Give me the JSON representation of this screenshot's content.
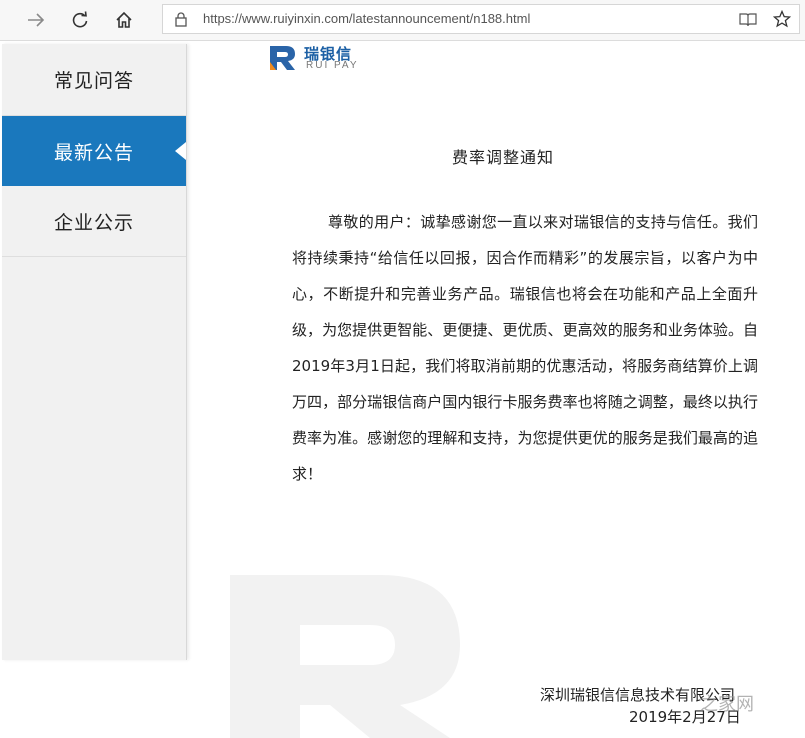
{
  "browser": {
    "url": "https://www.ruiyinxin.com/latestannouncement/n188.html"
  },
  "sidebar": {
    "items": [
      {
        "label": "常见问答"
      },
      {
        "label": "最新公告"
      },
      {
        "label": "企业公示"
      }
    ],
    "active_index": 1,
    "accent_color": "#1a78bd"
  },
  "logo": {
    "cn": "瑞银信",
    "en": "RUI PAY"
  },
  "notice": {
    "title": "费率调整通知",
    "body": "尊敬的用户：诚挚感谢您一直以来对瑞银信的支持与信任。我们将持续秉持“给信任以回报，因合作而精彩”的发展宗旨，以客户为中心，不断提升和完善业务产品。瑞银信也将会在功能和产品上全面升级，为您提供更智能、更便捷、更优质、更高效的服务和业务体验。自2019年3月1日起，我们将取消前期的优惠活动，将服务商结算价上调万四，部分瑞银信商户国内银行卡服务费率也将随之调整，最终以执行费率为准。感谢您的理解和支持，为您提供更优的服务是我们最高的追求！",
    "company": "深圳瑞银信信息技术有限公司",
    "date": "2019年2月27日"
  },
  "watermark": {
    "text": "之家网"
  }
}
